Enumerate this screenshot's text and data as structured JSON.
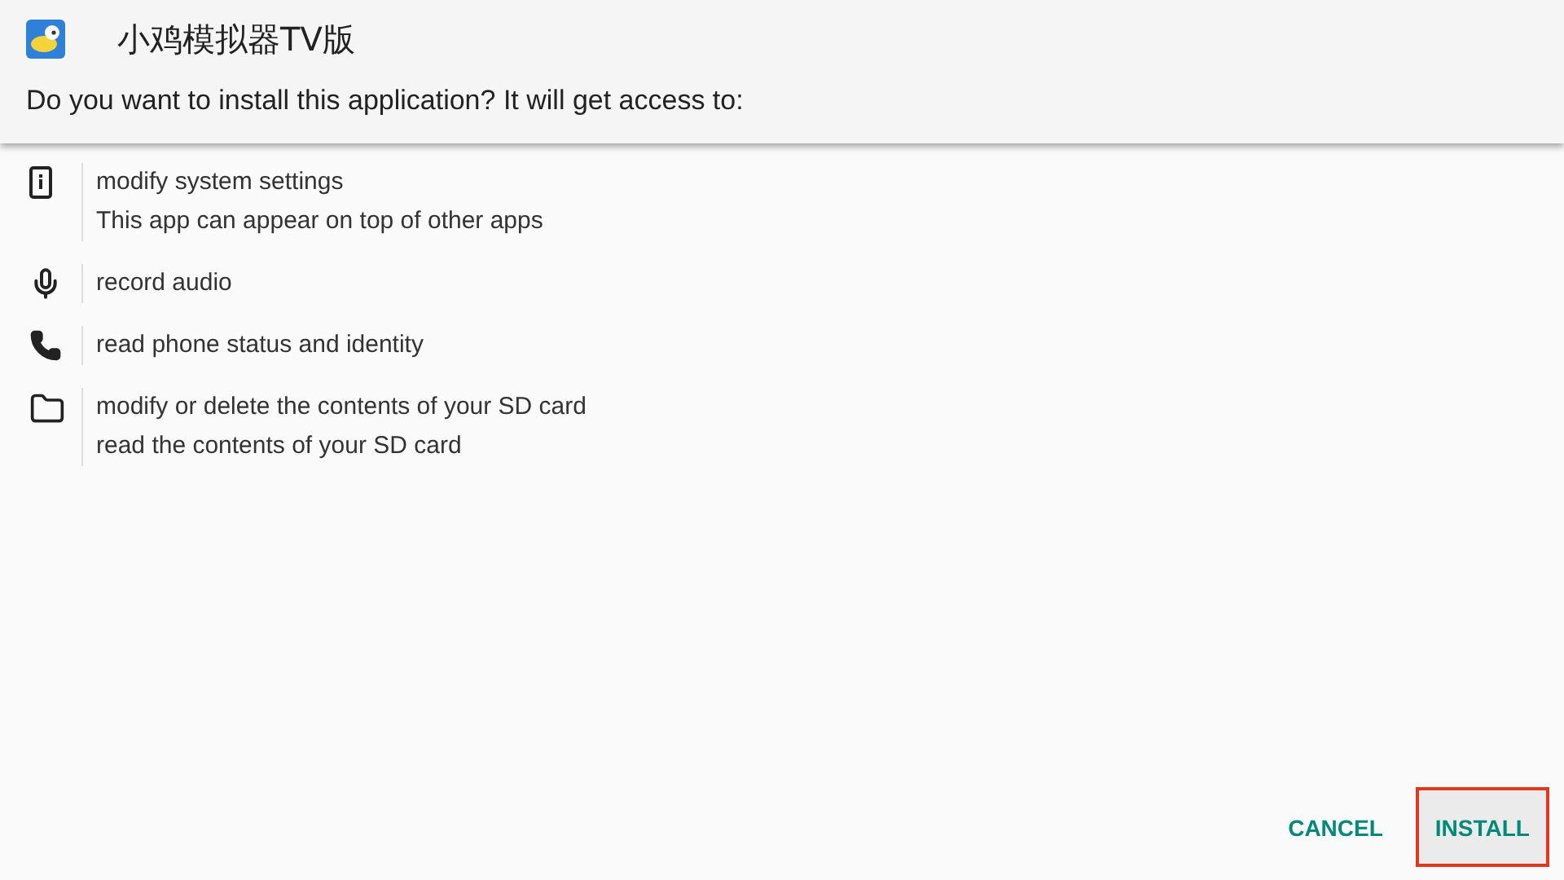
{
  "app": {
    "title": "小鸡模拟器TV版"
  },
  "prompt": "Do you want to install this application? It will get access to:",
  "permissions": [
    {
      "kind": "device-info",
      "lines": [
        "modify system settings",
        "This app can appear on top of other apps"
      ]
    },
    {
      "kind": "microphone",
      "lines": [
        "record audio"
      ]
    },
    {
      "kind": "phone",
      "lines": [
        "read phone status and identity"
      ]
    },
    {
      "kind": "folder",
      "lines": [
        "modify or delete the contents of your SD card",
        "read the contents of your SD card"
      ]
    }
  ],
  "buttons": [
    {
      "label": "CANCEL",
      "focused": false
    },
    {
      "label": "INSTALL",
      "focused": true
    }
  ]
}
